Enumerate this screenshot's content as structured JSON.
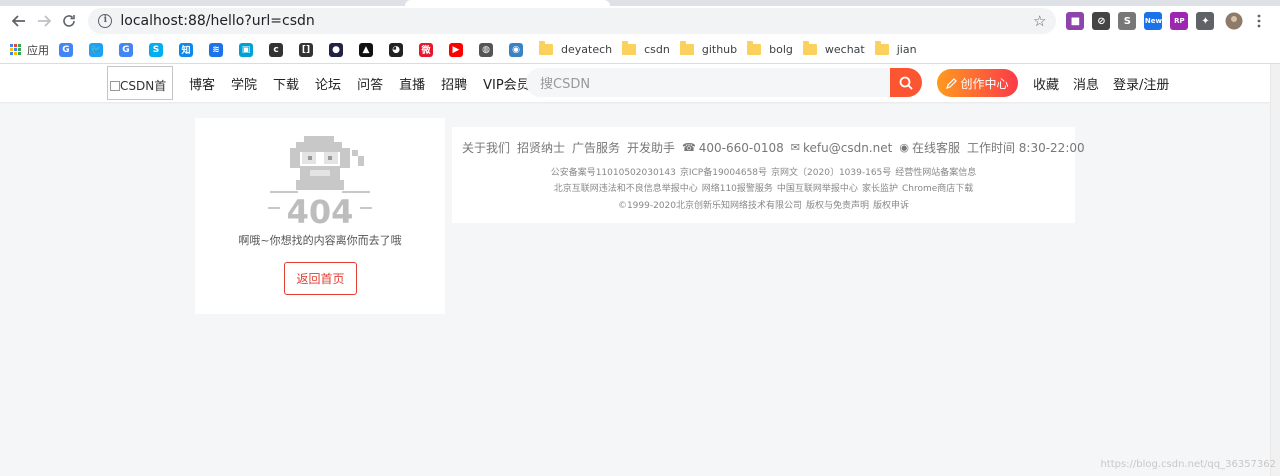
{
  "browser": {
    "url": "localhost:88/hello?url=csdn",
    "bookmarks": [
      {
        "label": "应用",
        "icon": "apps-icon"
      },
      {
        "label": "",
        "icon": "google-icon",
        "color": "#4285f4",
        "glyph": "G"
      },
      {
        "label": "",
        "icon": "twitter-icon",
        "color": "#1da1f2",
        "glyph": "🐦"
      },
      {
        "label": "",
        "icon": "translate-icon",
        "color": "#4285f4",
        "glyph": "G"
      },
      {
        "label": "",
        "icon": "skype-icon",
        "color": "#00aff0",
        "glyph": "S"
      },
      {
        "label": "",
        "icon": "zhihu-icon",
        "color": "#0f88eb",
        "glyph": "知"
      },
      {
        "label": "",
        "icon": "wifi-icon",
        "color": "#1a73e8",
        "glyph": "≋"
      },
      {
        "label": "",
        "icon": "bilibili-icon",
        "color": "#00a1d6",
        "glyph": "▣"
      },
      {
        "label": "",
        "icon": "c-icon",
        "color": "#333333",
        "glyph": "c"
      },
      {
        "label": "",
        "icon": "bracket-icon",
        "color": "#333333",
        "glyph": "[]"
      },
      {
        "label": "",
        "icon": "dot-icon",
        "color": "#222244",
        "glyph": "●"
      },
      {
        "label": "",
        "icon": "triangle-icon",
        "color": "#111111",
        "glyph": "▲"
      },
      {
        "label": "",
        "icon": "panda-icon",
        "color": "#222222",
        "glyph": "◕"
      },
      {
        "label": "",
        "icon": "weibo-icon",
        "color": "#e6162d",
        "glyph": "微"
      },
      {
        "label": "",
        "icon": "youtube-icon",
        "color": "#ff0000",
        "glyph": "▶"
      },
      {
        "label": "",
        "icon": "globe-icon",
        "color": "#555555",
        "glyph": "◍"
      },
      {
        "label": "",
        "icon": "swirl-icon",
        "color": "#3b82c4",
        "glyph": "◉"
      },
      {
        "label": "deyatech",
        "icon": "folder-icon"
      },
      {
        "label": "csdn",
        "icon": "folder-icon"
      },
      {
        "label": "github",
        "icon": "folder-icon"
      },
      {
        "label": "bolg",
        "icon": "folder-icon"
      },
      {
        "label": "wechat",
        "icon": "folder-icon"
      },
      {
        "label": "jian",
        "icon": "folder-icon"
      }
    ],
    "extensions": [
      {
        "icon": "extension-purple-icon",
        "color": "#8e44ad",
        "glyph": "■"
      },
      {
        "icon": "extension-clock-icon",
        "color": "#444444",
        "glyph": "⊘"
      },
      {
        "icon": "extension-s-icon",
        "color": "#777777",
        "glyph": "S"
      },
      {
        "icon": "extension-new-icon",
        "color": "#1a73e8",
        "glyph": "New"
      },
      {
        "icon": "extension-rp-icon",
        "color": "#9c27b0",
        "glyph": "RP"
      },
      {
        "icon": "puzzle-icon",
        "color": "#5f6368",
        "glyph": "✦"
      }
    ]
  },
  "header": {
    "logo_alt": "CSDN首",
    "nav": [
      "博客",
      "学院",
      "下载",
      "论坛",
      "问答",
      "直播",
      "招聘",
      "VIP会员"
    ],
    "search_placeholder": "搜CSDN",
    "create_label": "创作中心",
    "right_links": [
      "收藏",
      "消息",
      "登录/注册"
    ]
  },
  "error": {
    "code": "404",
    "message": "啊哦~你想找的内容离你而去了哦",
    "home_button": "返回首页"
  },
  "footer": {
    "links": [
      "关于我们",
      "招贤纳士",
      "广告服务",
      "开发助手"
    ],
    "phone": "400-660-0108",
    "email": "kefu@csdn.net",
    "online_service": "在线客服",
    "hours": "工作时间 8:30-22:00",
    "line2": [
      "公安备案号11010502030143",
      "京ICP备19004658号",
      "京网文〔2020〕1039-165号",
      "经营性网站备案信息"
    ],
    "line3": [
      "北京互联网违法和不良信息举报中心",
      "网络110报警服务",
      "中国互联网举报中心",
      "家长监护",
      "Chrome商店下载"
    ],
    "line4": [
      "©1999-2020北京创新乐知网络技术有限公司",
      "版权与免责声明",
      "版权申诉"
    ]
  },
  "watermark": "https://blog.csdn.net/qq_36357362",
  "colors": {
    "accent": "#fc5531",
    "error_red": "#e33e33"
  }
}
